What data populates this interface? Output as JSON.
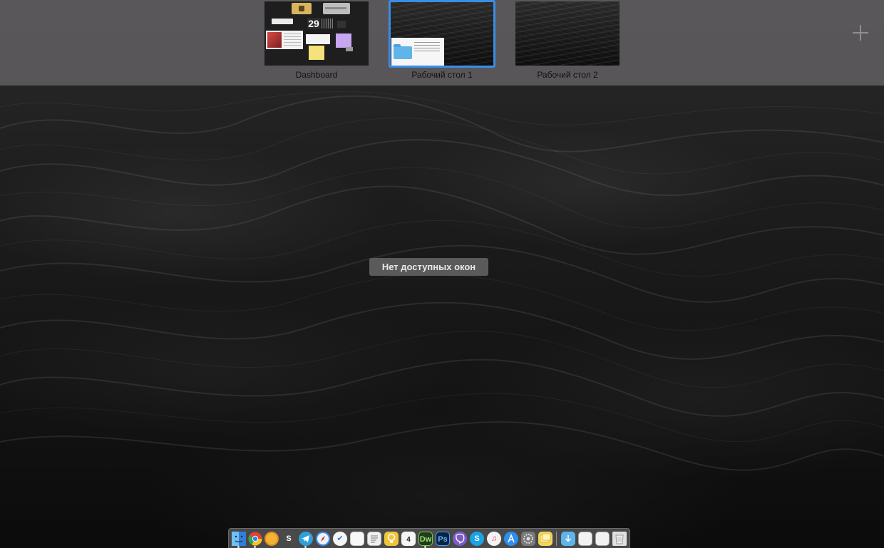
{
  "spaces": [
    {
      "label": "Dashboard",
      "active": false
    },
    {
      "label": "Рабочий стол 1",
      "active": true
    },
    {
      "label": "Рабочий стол 2",
      "active": false
    }
  ],
  "dashboard_widgets": {
    "calendar_day": "29"
  },
  "center_message": "Нет доступных окон",
  "dock": {
    "apps": [
      {
        "name": "Finder",
        "icon": "finder-icon",
        "color": "#3b8de0"
      },
      {
        "name": "Google Chrome",
        "icon": "chrome-icon",
        "color": "#e34133"
      },
      {
        "name": "Chromium",
        "icon": "chromium-icon",
        "color": "#f2b233"
      },
      {
        "name": "Sublime",
        "icon": "s-app-icon",
        "color": "#555555"
      },
      {
        "name": "Telegram",
        "icon": "telegram-icon",
        "color": "#2fa0db"
      },
      {
        "name": "Safari",
        "icon": "safari-icon",
        "color": "#3c8ff0"
      },
      {
        "name": "Todo",
        "icon": "checkmark-app-icon",
        "color": "#f5f5f5"
      },
      {
        "name": "Notes",
        "icon": "notes-icon",
        "color": "#f7f7f7"
      },
      {
        "name": "TextEdit",
        "icon": "textedit-icon",
        "color": "#f0f0f0"
      },
      {
        "name": "Ideas",
        "icon": "lightbulb-icon",
        "color": "#f0c53a"
      },
      {
        "name": "Calendar",
        "icon": "calendar-icon",
        "color": "#f5f5f5"
      },
      {
        "name": "Dreamweaver",
        "icon": "dreamweaver-icon",
        "color": "#1f3d1c"
      },
      {
        "name": "Photoshop",
        "icon": "photoshop-icon",
        "color": "#0c2340"
      },
      {
        "name": "Viber",
        "icon": "viber-icon",
        "color": "#7b5cc9"
      },
      {
        "name": "Skype",
        "icon": "skype-icon",
        "color": "#1aa3e6"
      },
      {
        "name": "iTunes",
        "icon": "itunes-icon",
        "color": "#f3f3f3"
      },
      {
        "name": "App Store",
        "icon": "app-store-icon",
        "color": "#2d8ef0"
      },
      {
        "name": "System Preferences",
        "icon": "gear-icon",
        "color": "#7a7a7a"
      },
      {
        "name": "Stickies",
        "icon": "stickies-icon",
        "color": "#f4d65a"
      }
    ],
    "stacks": [
      {
        "name": "Downloads",
        "icon": "folder-icon",
        "color": "#5fb5ea"
      },
      {
        "name": "Document 1",
        "icon": "document-icon",
        "color": "#f2f2f2"
      },
      {
        "name": "Document 2",
        "icon": "document-icon",
        "color": "#f2f2f2"
      },
      {
        "name": "Document 3",
        "icon": "document-icon",
        "color": "#f2f2f2"
      },
      {
        "name": "Trash",
        "icon": "trash-icon",
        "color": "#e0e0e0"
      }
    ],
    "dock_letters": {
      "sublime": "S",
      "dreamweaver": "Dw",
      "photoshop": "Ps",
      "skype": "S",
      "calendar": "4"
    }
  }
}
